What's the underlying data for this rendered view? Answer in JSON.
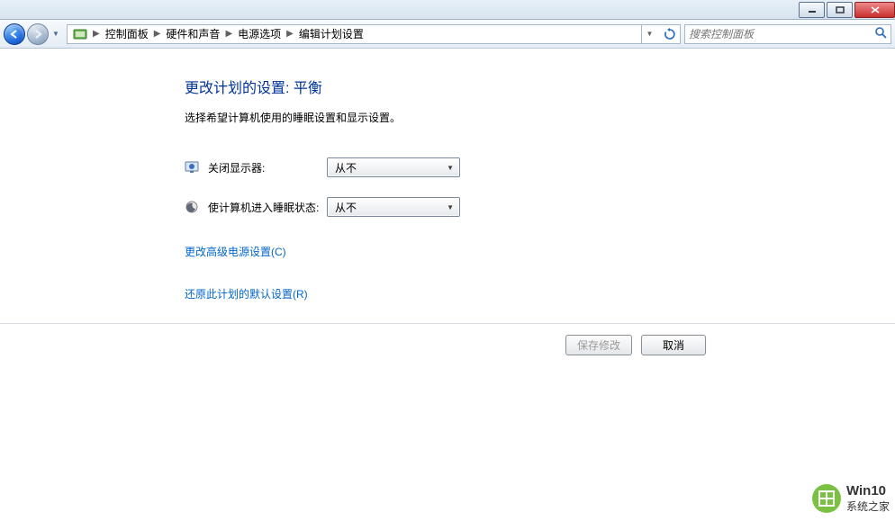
{
  "titlebar": {},
  "breadcrumb": {
    "seg1": "控制面板",
    "seg2": "硬件和声音",
    "seg3": "电源选项",
    "seg4": "编辑计划设置"
  },
  "search": {
    "placeholder": "搜索控制面板"
  },
  "main": {
    "heading": "更改计划的设置: 平衡",
    "subtext": "选择希望计算机使用的睡眠设置和显示设置。",
    "row1_label": "关闭显示器:",
    "row1_value": "从不",
    "row2_label": "使计算机进入睡眠状态:",
    "row2_value": "从不",
    "link1": "更改高级电源设置(C)",
    "link2": "还原此计划的默认设置(R)"
  },
  "footer": {
    "save": "保存修改",
    "cancel": "取消"
  },
  "watermark": {
    "line1": "Win10",
    "line2": "系统之家"
  }
}
